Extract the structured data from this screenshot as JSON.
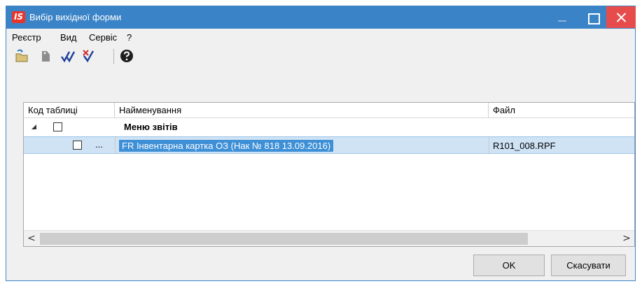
{
  "window": {
    "logo": "IS",
    "title": "Вибір вихідної форми"
  },
  "menu": {
    "items": [
      "Реєстр",
      "Вид",
      "Сервіс",
      "?"
    ]
  },
  "toolbar": {
    "icons": [
      "open-folder-icon",
      "tag-icon",
      "check-all-icon",
      "uncheck-all-icon",
      "help-icon"
    ]
  },
  "grid": {
    "columns": [
      "Код таблиці",
      "Найменування",
      "Файл"
    ],
    "group": {
      "label": "Меню звітів",
      "checked": false,
      "expanded": true
    },
    "rows": [
      {
        "code": "...",
        "name": "FR Інвентарна картка ОЗ (Нак № 818 13.09.2016)",
        "file": "R101_008.RPF",
        "checked": false,
        "selected": true
      }
    ]
  },
  "scrollbar": {
    "left": "<",
    "right": ">"
  },
  "buttons": {
    "ok": "OK",
    "cancel": "Скасувати"
  },
  "colors": {
    "titlebar": "#3a83c6",
    "close": "#e74c4c",
    "selection": "#cfe3f5",
    "highlight": "#3d8fd6"
  }
}
